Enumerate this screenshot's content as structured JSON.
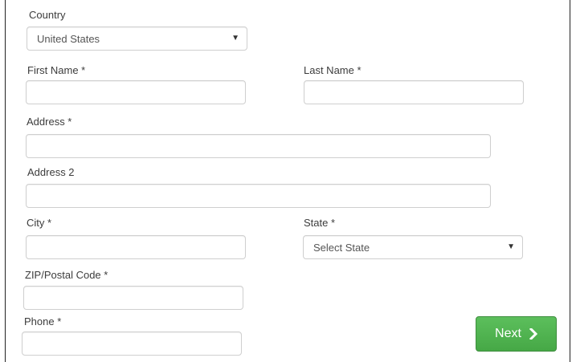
{
  "form": {
    "country": {
      "label": "Country",
      "selected": "United States"
    },
    "first_name": {
      "label": "First Name *",
      "value": ""
    },
    "last_name": {
      "label": "Last Name *",
      "value": ""
    },
    "address": {
      "label": "Address *",
      "value": ""
    },
    "address2": {
      "label": "Address 2",
      "value": ""
    },
    "city": {
      "label": "City *",
      "value": ""
    },
    "state": {
      "label": "State *",
      "selected": "Select State"
    },
    "zip": {
      "label": "ZIP/Postal Code *",
      "value": ""
    },
    "phone": {
      "label": "Phone *",
      "value": ""
    }
  },
  "actions": {
    "next_label": "Next"
  },
  "colors": {
    "next_button": "#4cae4c",
    "field_border": "#cfcfcf",
    "label_text": "#3c3c3c"
  },
  "icons": {
    "caret": "caret-down-icon",
    "next": "chevron-right-icon"
  }
}
